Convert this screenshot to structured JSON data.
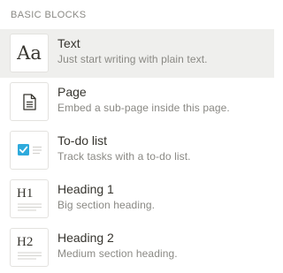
{
  "section": {
    "title": "BASIC BLOCKS"
  },
  "items": [
    {
      "title": "Text",
      "description": "Just start writing with plain text.",
      "icon": "text-aa-icon",
      "glyph": "Aa"
    },
    {
      "title": "Page",
      "description": "Embed a sub-page inside this page.",
      "icon": "page-document-icon"
    },
    {
      "title": "To-do list",
      "description": "Track tasks with a to-do list.",
      "icon": "todo-checkbox-icon"
    },
    {
      "title": "Heading 1",
      "description": "Big section heading.",
      "icon": "heading-1-icon",
      "glyph": "H1"
    },
    {
      "title": "Heading 2",
      "description": "Medium section heading.",
      "icon": "heading-2-icon",
      "glyph": "H2"
    }
  ],
  "colors": {
    "hover_background": "#efefed",
    "checkbox_accent": "#2eaadc",
    "secondary_text": "#8a8984"
  }
}
